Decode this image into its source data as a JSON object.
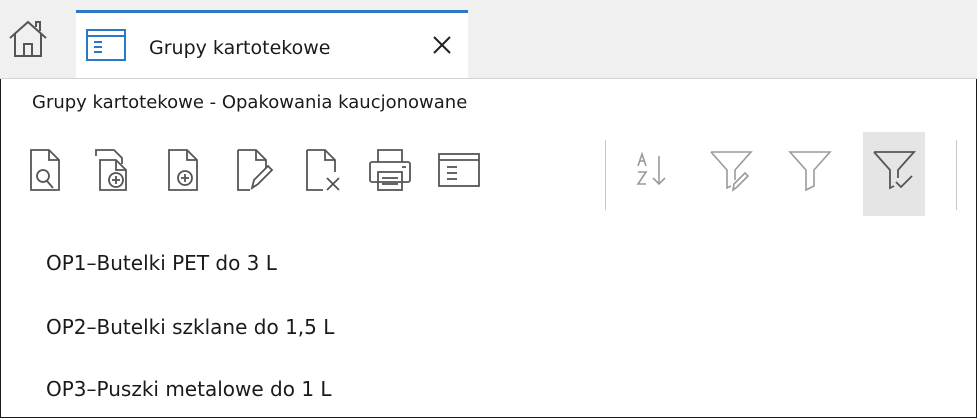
{
  "tabbar": {
    "home_icon": "home-icon",
    "tab": {
      "icon": "list-window-icon",
      "label": "Grupy kartotekowe",
      "close_icon": "close-icon"
    }
  },
  "page": {
    "title": "Grupy kartotekowe - Opakowania kaucjonowane"
  },
  "toolbar": {
    "buttons": [
      {
        "icon": "document-search-icon",
        "state": "enabled"
      },
      {
        "icon": "document-copy-add-icon",
        "state": "enabled"
      },
      {
        "icon": "document-add-icon",
        "state": "enabled"
      },
      {
        "icon": "document-edit-icon",
        "state": "enabled"
      },
      {
        "icon": "document-delete-icon",
        "state": "enabled"
      },
      {
        "icon": "print-icon",
        "state": "enabled"
      },
      {
        "icon": "list-view-icon",
        "state": "enabled"
      },
      {
        "icon": "sort-az-icon",
        "state": "disabled"
      },
      {
        "icon": "filter-edit-icon",
        "state": "disabled"
      },
      {
        "icon": "filter-icon",
        "state": "disabled"
      },
      {
        "icon": "filter-check-icon",
        "state": "active"
      }
    ]
  },
  "items": [
    {
      "label": "OP1–Butelki PET do 3 L"
    },
    {
      "label": "OP2–Butelki szklane do 1,5 L"
    },
    {
      "label": "OP3–Puszki metalowe do 1 L"
    }
  ],
  "colors": {
    "accent": "#2b78c5",
    "icon": "#555555",
    "disabled": "#9a9a9a",
    "active_bg": "#e5e5e5"
  }
}
